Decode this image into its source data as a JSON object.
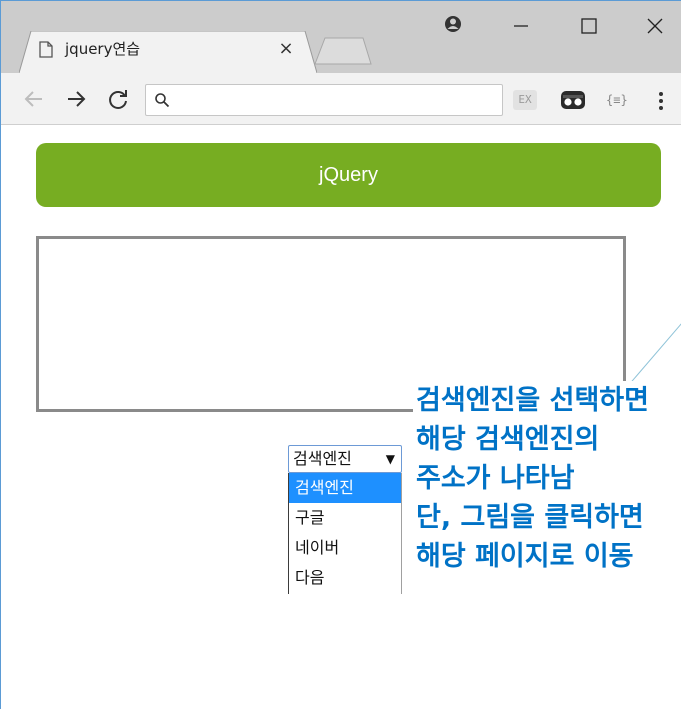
{
  "browser": {
    "tab_title": "jquery연습",
    "tab_close": "×",
    "address": "",
    "extension_ex_label": "EX",
    "extension_json_label": "{≡}"
  },
  "page": {
    "banner_text": "jQuery",
    "select": {
      "selected_value": "검색엔진",
      "arrow": "▼",
      "options": [
        "검색엔진",
        "구글",
        "네이버",
        "다음"
      ],
      "highlighted_index": 0
    }
  },
  "annotation": {
    "lines": [
      "검색엔진을 선택하면",
      "해당 검색엔진의",
      "주소가 나타남",
      "단, 그림을 클릭하면",
      "해당 페이지로 이동"
    ]
  },
  "colors": {
    "banner": "#77ad22",
    "annotation_text": "#0072c6",
    "option_highlight": "#1e90ff"
  }
}
